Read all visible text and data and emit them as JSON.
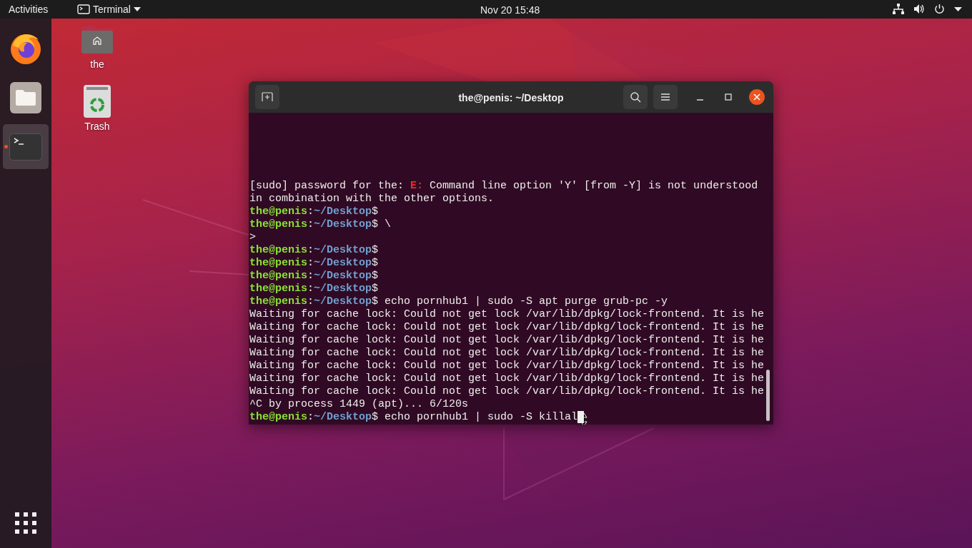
{
  "top_bar": {
    "activities": "Activities",
    "app_menu": "Terminal",
    "clock": "Nov 20  15:48"
  },
  "dock": {
    "items": [
      {
        "kind": "browser",
        "selected": false,
        "running": false
      },
      {
        "kind": "files",
        "selected": false,
        "running": false
      },
      {
        "kind": "terminal",
        "selected": true,
        "running": true
      }
    ]
  },
  "desktop_icons": [
    {
      "kind": "home",
      "label": "the"
    },
    {
      "kind": "trash",
      "label": "Trash"
    }
  ],
  "terminal": {
    "title": "the@penis: ~/Desktop",
    "lines": [
      [
        {
          "kind": "plain",
          "text": "[sudo] password for the: "
        },
        {
          "kind": "error",
          "text": "E:"
        },
        {
          "kind": "plain",
          "text": " Command line option 'Y' [from -Y] is not understood"
        }
      ],
      [
        {
          "kind": "plain",
          "text": "in combination with the other options."
        }
      ],
      [
        {
          "kind": "user",
          "text": "the@penis"
        },
        {
          "kind": "plain",
          "text": ":"
        },
        {
          "kind": "path",
          "text": "~/Desktop"
        },
        {
          "kind": "plain",
          "text": "$"
        }
      ],
      [
        {
          "kind": "user",
          "text": "the@penis"
        },
        {
          "kind": "plain",
          "text": ":"
        },
        {
          "kind": "path",
          "text": "~/Desktop"
        },
        {
          "kind": "plain",
          "text": "$ \\"
        }
      ],
      [
        {
          "kind": "plain",
          "text": ">"
        }
      ],
      [
        {
          "kind": "user",
          "text": "the@penis"
        },
        {
          "kind": "plain",
          "text": ":"
        },
        {
          "kind": "path",
          "text": "~/Desktop"
        },
        {
          "kind": "plain",
          "text": "$"
        }
      ],
      [
        {
          "kind": "user",
          "text": "the@penis"
        },
        {
          "kind": "plain",
          "text": ":"
        },
        {
          "kind": "path",
          "text": "~/Desktop"
        },
        {
          "kind": "plain",
          "text": "$"
        }
      ],
      [
        {
          "kind": "user",
          "text": "the@penis"
        },
        {
          "kind": "plain",
          "text": ":"
        },
        {
          "kind": "path",
          "text": "~/Desktop"
        },
        {
          "kind": "plain",
          "text": "$"
        }
      ],
      [
        {
          "kind": "user",
          "text": "the@penis"
        },
        {
          "kind": "plain",
          "text": ":"
        },
        {
          "kind": "path",
          "text": "~/Desktop"
        },
        {
          "kind": "plain",
          "text": "$"
        }
      ],
      [
        {
          "kind": "user",
          "text": "the@penis"
        },
        {
          "kind": "plain",
          "text": ":"
        },
        {
          "kind": "path",
          "text": "~/Desktop"
        },
        {
          "kind": "plain",
          "text": "$ echo pornhub1 | sudo -S apt purge grub-pc -y"
        }
      ],
      [
        {
          "kind": "plain",
          "text": "Waiting for cache lock: Could not get lock /var/lib/dpkg/lock-frontend. It is he"
        }
      ],
      [
        {
          "kind": "plain",
          "text": "Waiting for cache lock: Could not get lock /var/lib/dpkg/lock-frontend. It is he"
        }
      ],
      [
        {
          "kind": "plain",
          "text": "Waiting for cache lock: Could not get lock /var/lib/dpkg/lock-frontend. It is he"
        }
      ],
      [
        {
          "kind": "plain",
          "text": "Waiting for cache lock: Could not get lock /var/lib/dpkg/lock-frontend. It is he"
        }
      ],
      [
        {
          "kind": "plain",
          "text": "Waiting for cache lock: Could not get lock /var/lib/dpkg/lock-frontend. It is he"
        }
      ],
      [
        {
          "kind": "plain",
          "text": "Waiting for cache lock: Could not get lock /var/lib/dpkg/lock-frontend. It is he"
        }
      ],
      [
        {
          "kind": "plain",
          "text": "Waiting for cache lock: Could not get lock /var/lib/dpkg/lock-frontend. It is he"
        }
      ],
      [
        {
          "kind": "plain",
          "text": "^C by process 1449 (apt)... 6/120s"
        }
      ],
      [
        {
          "kind": "user",
          "text": "the@penis"
        },
        {
          "kind": "plain",
          "text": ":"
        },
        {
          "kind": "path",
          "text": "~/Desktop"
        },
        {
          "kind": "plain",
          "text": "$ echo pornhub1 | sudo -S killal"
        },
        {
          "kind": "cursor"
        }
      ]
    ]
  }
}
